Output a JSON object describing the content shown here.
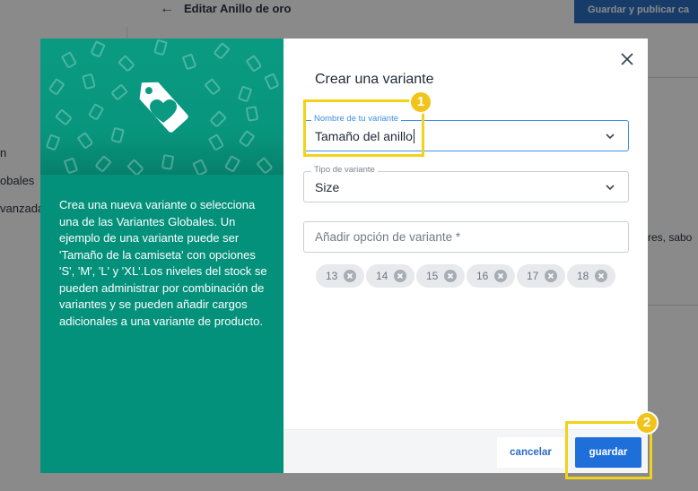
{
  "background": {
    "page_title": "Editar Anillo de oro",
    "publish_button": "Guardar y publicar ca",
    "nav_items": [
      "n",
      "obales",
      "vanzada"
    ],
    "right_text": "res, sabo"
  },
  "modal": {
    "title": "Crear una variante",
    "description": "Crea una nueva variante o selecciona una de las Variantes Globales. Un ejemplo de una variante puede ser 'Tamaño de la camiseta' con opciones 'S', 'M', 'L' y 'XL'.Los niveles del stock se pueden administrar por combinación de variantes y se pueden añadir cargos adicionales a una variante de producto.",
    "variant_name": {
      "label": "Nombre de tu variante",
      "value": "Tamaño del anillo"
    },
    "variant_type": {
      "label": "Tipo de variante",
      "value": "Size"
    },
    "add_option": {
      "placeholder": "Añadir opción de variante *"
    },
    "options": [
      "13",
      "14",
      "15",
      "16",
      "17",
      "18"
    ],
    "cancel_label": "cancelar",
    "save_label": "guardar"
  },
  "annotations": {
    "badge_1": "1",
    "badge_2": "2"
  },
  "colors": {
    "teal_panel": "#04917b",
    "primary_blue": "#1e6fd9",
    "highlight_yellow": "#f2d21b",
    "focus_blue": "#3d8ee6"
  },
  "icons": {
    "hero": "price-tag-heart-icon",
    "close": "close-icon",
    "dropdown": "chevron-down-icon",
    "chip_remove": "remove-circle-icon",
    "back": "arrow-left-icon"
  }
}
